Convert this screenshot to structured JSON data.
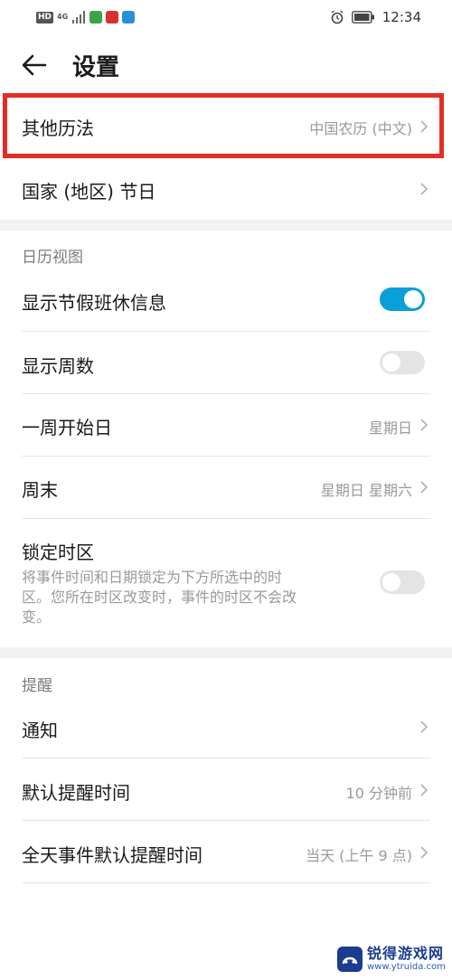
{
  "status_bar": {
    "hd": "HD",
    "network": "4G",
    "time": "12:34",
    "icons": [
      "signal-icon",
      "app-green-icon",
      "app-red-icon",
      "app-blue-icon",
      "alarm-icon",
      "battery-icon"
    ]
  },
  "header": {
    "title": "设置"
  },
  "general": {
    "other_calendar": {
      "label": "其他历法",
      "value": "中国农历 (中文)"
    },
    "holidays": {
      "label": "国家 (地区) 节日"
    }
  },
  "calendar_view": {
    "section_title": "日历视图",
    "show_holidays": {
      "label": "显示节假班休信息",
      "enabled": true
    },
    "show_week_numbers": {
      "label": "显示周数",
      "enabled": false
    },
    "week_start": {
      "label": "一周开始日",
      "value": "星期日"
    },
    "weekend": {
      "label": "周末",
      "value": "星期日 星期六"
    },
    "lock_timezone": {
      "label": "锁定时区",
      "desc_line1": "将事件时间和日期锁定为下方所选中的时",
      "desc_line2": "区。您所在时区改变时，事件的时区不会改",
      "desc_line3": "变。",
      "enabled": false
    }
  },
  "reminders": {
    "section_title": "提醒",
    "notifications": {
      "label": "通知"
    },
    "default_reminder": {
      "label": "默认提醒时间",
      "value": "10 分钟前"
    },
    "allday_reminder": {
      "label": "全天事件默认提醒时间",
      "value": "当天 (上午 9 点)"
    }
  },
  "watermark": {
    "title": "锐得游戏网",
    "url": "www.ytruida.com"
  },
  "colors": {
    "accent": "#0a9fd8",
    "highlight": "#e52d27",
    "section_bg": "#f2f2f2"
  }
}
